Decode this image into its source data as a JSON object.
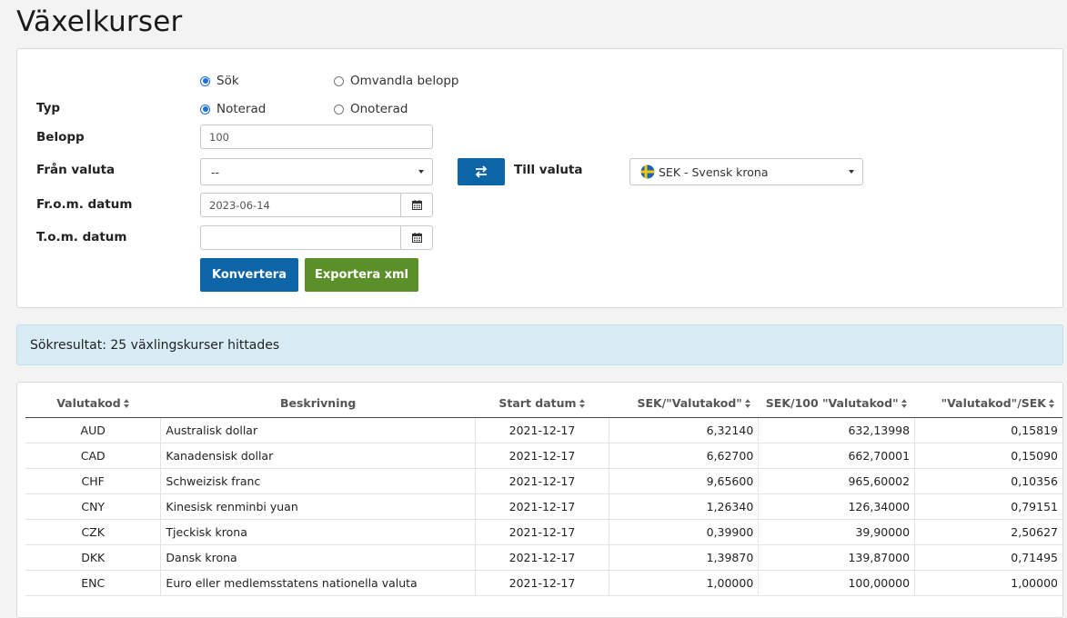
{
  "page": {
    "title": "Växelkurser"
  },
  "form": {
    "mode_options": [
      {
        "label": "Sök",
        "checked": true
      },
      {
        "label": "Omvandla belopp",
        "checked": false
      }
    ],
    "typ_label": "Typ",
    "typ_options": [
      {
        "label": "Noterad",
        "checked": true
      },
      {
        "label": "Onoterad",
        "checked": false
      }
    ],
    "belopp_label": "Belopp",
    "belopp_value": "100",
    "fran_label": "Från valuta",
    "fran_value": "--",
    "till_label": "Till valuta",
    "till_value": "SEK - Svensk krona",
    "from_date_label": "Fr.o.m. datum",
    "from_date_value": "2023-06-14",
    "to_date_label": "T.o.m. datum",
    "to_date_value": "",
    "convert_label": "Konvertera",
    "export_label": "Exportera xml",
    "swap_icon": "swap-arrows-icon",
    "calendar_icon": "calendar-icon"
  },
  "result": {
    "message": "Sökresultat: 25 växlingskurser hittades"
  },
  "table": {
    "headers": [
      "Valutakod",
      "Beskrivning",
      "Start datum",
      "SEK/\"Valutakod\"",
      "SEK/100 \"Valutakod\"",
      "\"Valutakod\"/SEK"
    ],
    "rows": [
      [
        "AUD",
        "Australisk dollar",
        "2021-12-17",
        "6,32140",
        "632,13998",
        "0,15819"
      ],
      [
        "CAD",
        "Kanadensisk dollar",
        "2021-12-17",
        "6,62700",
        "662,70001",
        "0,15090"
      ],
      [
        "CHF",
        "Schweizisk franc",
        "2021-12-17",
        "9,65600",
        "965,60002",
        "0,10356"
      ],
      [
        "CNY",
        "Kinesisk renminbi yuan",
        "2021-12-17",
        "1,26340",
        "126,34000",
        "0,79151"
      ],
      [
        "CZK",
        "Tjeckisk krona",
        "2021-12-17",
        "0,39900",
        "39,90000",
        "2,50627"
      ],
      [
        "DKK",
        "Dansk krona",
        "2021-12-17",
        "1,39870",
        "139,87000",
        "0,71495"
      ],
      [
        "ENC",
        "Euro eller medlemsstatens nationella valuta",
        "2021-12-17",
        "1,00000",
        "100,00000",
        "1,00000"
      ]
    ]
  },
  "colors": {
    "primary": "#0d65a8",
    "success": "#5a8f2a",
    "info_bg": "#d8ecf5"
  }
}
